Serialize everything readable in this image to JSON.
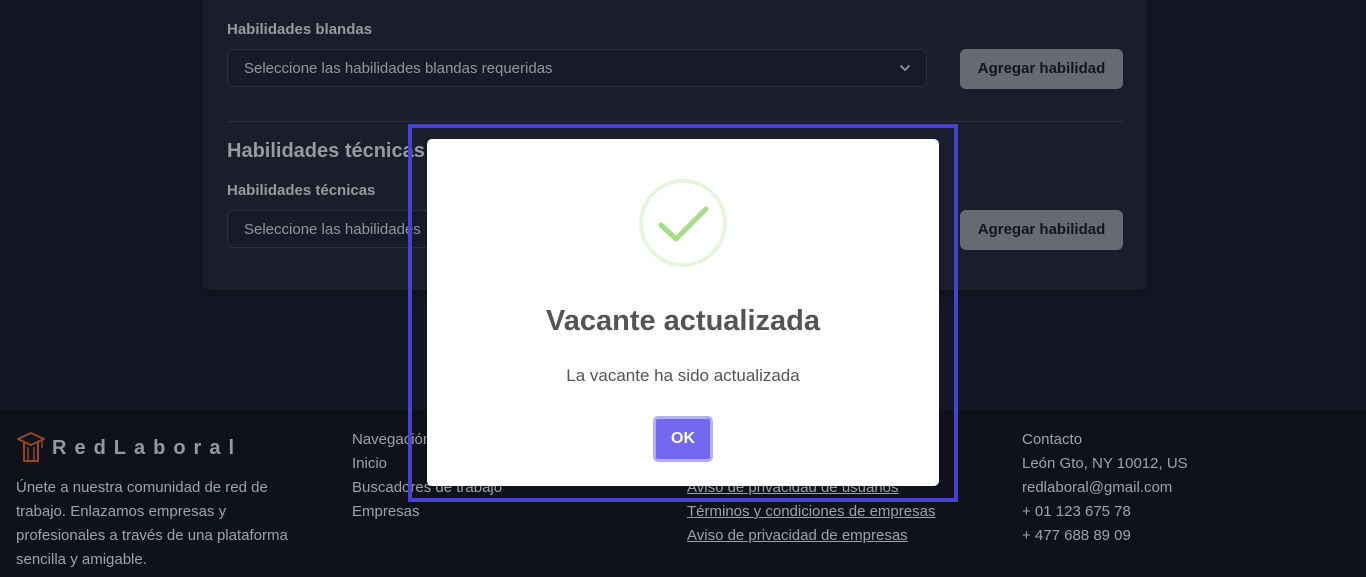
{
  "form": {
    "soft_skills_label": "Habilidades blandas",
    "soft_skills_placeholder": "Seleccione las habilidades blandas requeridas",
    "add_skill_label": "Agregar habilidad",
    "tech_section_title": "Habilidades técnicas",
    "tech_skills_label": "Habilidades técnicas",
    "tech_skills_placeholder": "Seleccione las habilidades"
  },
  "footer": {
    "logo_text": "RedLaboral",
    "description": "Únete a nuestra comunidad de red de trabajo. Enlazamos empresas y profesionales a través de una plataforma sencilla y amigable.",
    "nav": {
      "title": "Navegación",
      "items": [
        "Inicio",
        "Buscadores de trabajo",
        "Empresas"
      ]
    },
    "legal": {
      "items": [
        "Aviso de privacidad de usuarios",
        "Términos y condiciones de empresas",
        "Aviso de privacidad de empresas"
      ]
    },
    "contact": {
      "title": "Contacto",
      "address": "León Gto, NY 10012, US",
      "email": "redlaboral@gmail.com",
      "phone1": "+ 01 123 675 78",
      "phone2": "+ 477 688 89 09"
    }
  },
  "modal": {
    "icon": "success-check-icon",
    "title": "Vacante actualizada",
    "message": "La vacante ha sido actualizada",
    "ok_label": "OK"
  },
  "colors": {
    "accent": "#7367f0",
    "focus_frame": "#4842d1",
    "success": "#a5dc86"
  }
}
